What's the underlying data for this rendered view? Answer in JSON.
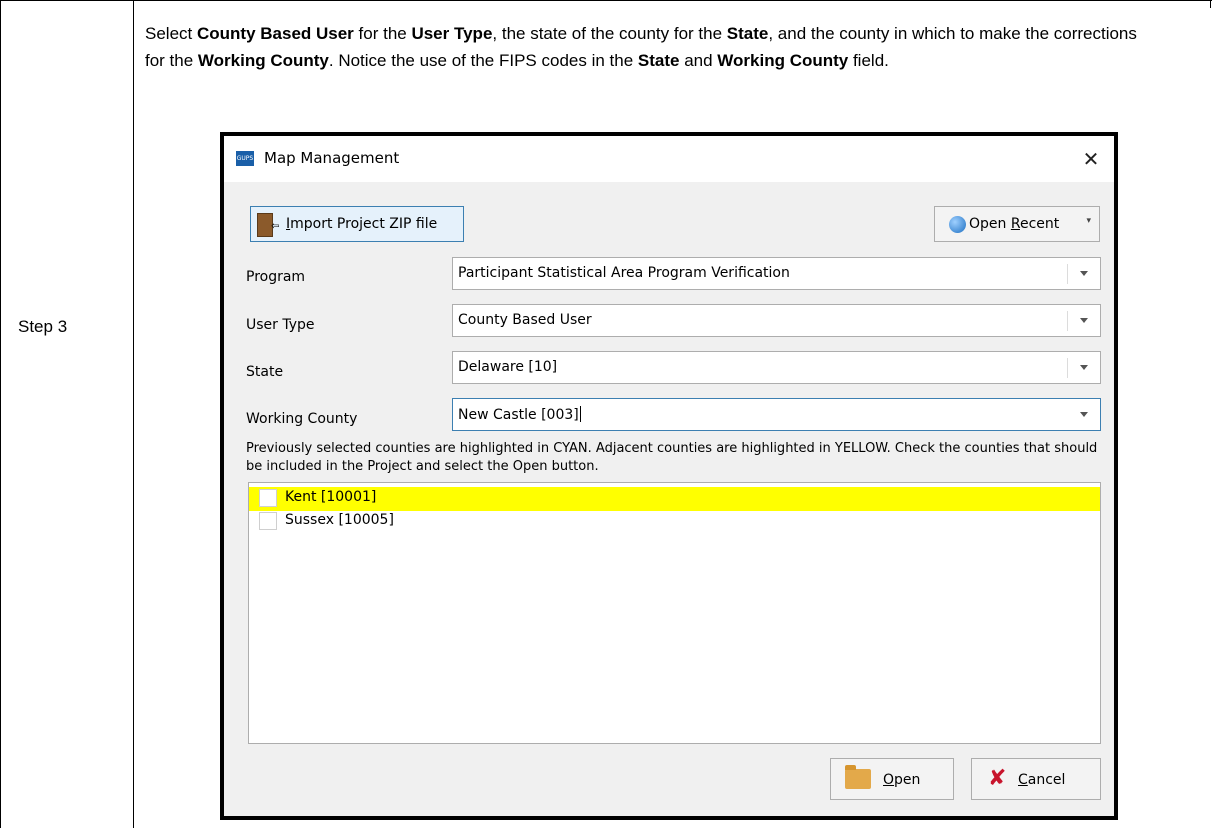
{
  "step_label": "Step 3",
  "instruction": {
    "t1": "Select ",
    "b1": "County Based User",
    "t2": " for the ",
    "b2": "User Type",
    "t3": ", the state of the county for the ",
    "b3": "State",
    "t4": ", and the county in which to make the corrections for the ",
    "b4": "Working County",
    "t5": ". Notice the use of the FIPS codes in the ",
    "b5": "State",
    "t6": " and ",
    "b6": "Working County",
    "t7": " field."
  },
  "dialog": {
    "app_icon_text": "GUPS",
    "title": "Map Management",
    "close_glyph": "✕",
    "import_button": {
      "prefix": "⇦",
      "underline": "I",
      "rest": "mport Project ZIP file"
    },
    "open_recent_button": {
      "prefix": "Open ",
      "underline": "R",
      "rest": "ecent",
      "caret": "▾"
    },
    "fields": {
      "program": {
        "label": "Program",
        "value": "Participant Statistical Area Program Verification"
      },
      "user_type": {
        "label": "User Type",
        "value": "County Based User"
      },
      "state": {
        "label": "State",
        "value": "Delaware [10]"
      },
      "working_county": {
        "label": "Working County",
        "value": "New Castle [003]"
      }
    },
    "info_text": "Previously selected counties are highlighted in CYAN. Adjacent counties are highlighted in YELLOW. Check the counties that should be included in the Project and select the Open button.",
    "counties": [
      {
        "label": "Kent [10001]",
        "checked": false,
        "highlight": "#ffff00"
      },
      {
        "label": "Sussex [10005]",
        "checked": false,
        "highlight": ""
      }
    ],
    "open_button": {
      "underline": "O",
      "rest": "pen"
    },
    "cancel_button": {
      "icon": "✘",
      "underline": "C",
      "rest": "ancel"
    }
  }
}
